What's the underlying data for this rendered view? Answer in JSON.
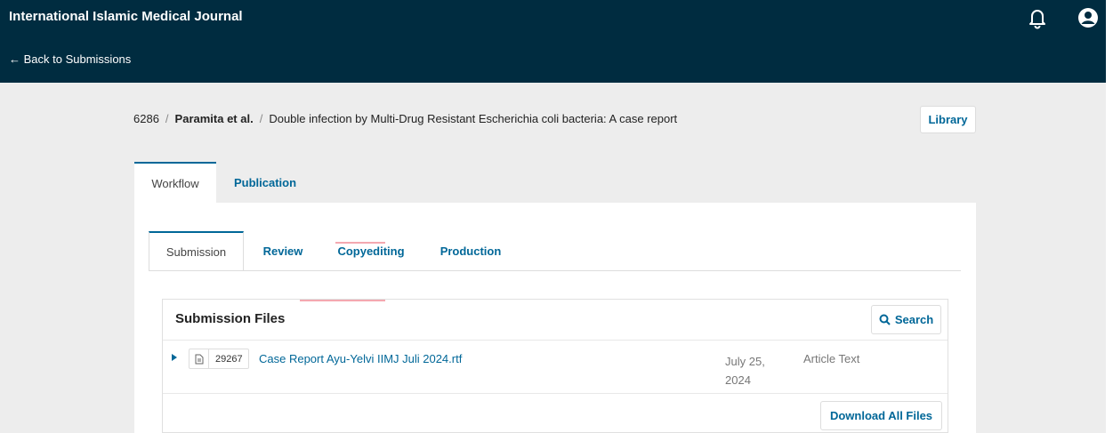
{
  "header": {
    "journal_title": "International Islamic Medical Journal",
    "back_link": "← Back to Submissions",
    "icons": [
      "bell-icon",
      "user-icon"
    ]
  },
  "breadcrumb": {
    "id": "6286",
    "author": "Paramita et al.",
    "title": "Double infection by Multi-Drug Resistant Escherichia coli bacteria: A case report",
    "separator": "/"
  },
  "library_button": "Library",
  "main_tabs": [
    {
      "label": "Workflow",
      "active": true
    },
    {
      "label": "Publication",
      "active": false
    }
  ],
  "workflow_tabs": [
    {
      "label": "Submission",
      "active": true
    },
    {
      "label": "Review",
      "active": false
    },
    {
      "label": "Copyediting",
      "active": false
    },
    {
      "label": "Production",
      "active": false
    }
  ],
  "files_panel": {
    "title": "Submission Files",
    "search_label": "Search",
    "download_all_label": "Download All Files",
    "files": [
      {
        "id": "29267",
        "name": "Case Report Ayu-Yelvi IIMJ Juli 2024.rtf",
        "date": "July 25, 2024",
        "type": "Article Text"
      }
    ]
  },
  "colors": {
    "header_bg": "#002c40",
    "link": "#006798",
    "page_bg": "#ededed",
    "highlight": "#f4a8b0"
  }
}
